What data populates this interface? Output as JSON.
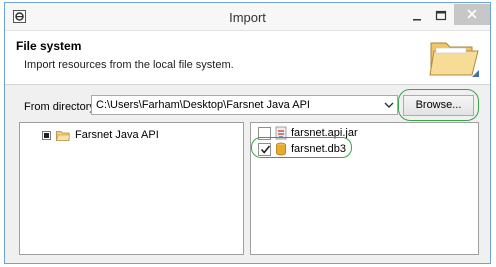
{
  "window": {
    "title": "Import",
    "icons": {
      "app": "eclipse-icon",
      "minimize": "minimize-icon",
      "maximize": "maximize-icon",
      "close": "close-icon"
    }
  },
  "header": {
    "title": "File system",
    "description": "Import resources from the local file system.",
    "icon": "open-folder-icon"
  },
  "directory": {
    "label": "From directory:",
    "value": "C:\\Users\\Farham\\Desktop\\Farsnet Java API",
    "browse_label": "Browse..."
  },
  "folder_tree": [
    {
      "label": "Farsnet Java API",
      "state": "partial",
      "icon": "folder-icon"
    }
  ],
  "files": [
    {
      "label": "farsnet.api.jar",
      "checked": false,
      "icon": "jar-file-icon"
    },
    {
      "label": "farsnet.db3",
      "checked": true,
      "icon": "database-file-icon"
    }
  ],
  "highlight_color": "#3aa34a"
}
